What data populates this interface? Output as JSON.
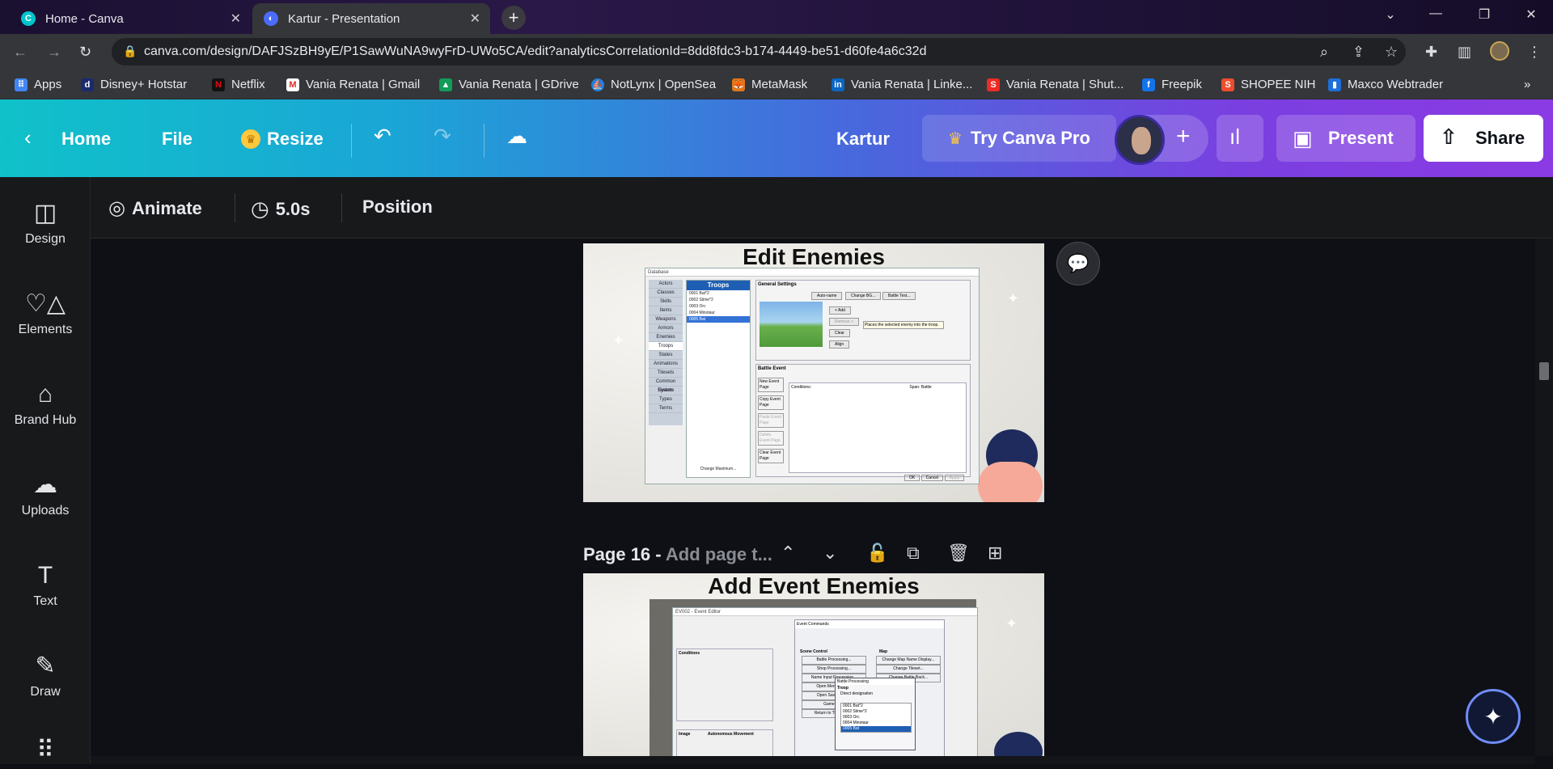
{
  "browser": {
    "tabs": [
      {
        "title": "Home - Canva",
        "active": false
      },
      {
        "title": "Kartur - Presentation",
        "active": true
      }
    ],
    "url": "canva.com/design/DAFJSzBH9yE/P1SawWuNA9wyFrD-UWo5CA/edit?analyticsCorrelationId=8dd8fdc3-b174-4449-be51-d60fe4a6c32d",
    "bookmarks": [
      {
        "label": "Apps",
        "icon": "apps-grid-icon"
      },
      {
        "label": "Disney+ Hotstar",
        "icon": "hotstar-icon"
      },
      {
        "label": "Netflix",
        "icon": "netflix-icon"
      },
      {
        "label": "Vania Renata | Gmail",
        "icon": "gmail-icon"
      },
      {
        "label": "Vania Renata | GDrive",
        "icon": "gdrive-icon"
      },
      {
        "label": "NotLynx | OpenSea",
        "icon": "opensea-icon"
      },
      {
        "label": "MetaMask",
        "icon": "metamask-icon"
      },
      {
        "label": "Vania Renata | Linke...",
        "icon": "linkedin-icon"
      },
      {
        "label": "Vania Renata | Shut...",
        "icon": "shutterstock-icon"
      },
      {
        "label": "Freepik",
        "icon": "freepik-icon"
      },
      {
        "label": "SHOPEE NIH",
        "icon": "shopee-icon"
      },
      {
        "label": "Maxco Webtrader",
        "icon": "maxco-icon"
      }
    ],
    "more_bookmarks": "»"
  },
  "canva_header": {
    "home": "Home",
    "file": "File",
    "resize": "Resize",
    "design_name": "Kartur",
    "try_pro": "Try Canva Pro",
    "present": "Present",
    "share": "Share"
  },
  "sidebar": {
    "items": [
      {
        "label": "Design",
        "icon": "layout-icon"
      },
      {
        "label": "Elements",
        "icon": "shapes-icon"
      },
      {
        "label": "Brand Hub",
        "icon": "brand-hub-icon"
      },
      {
        "label": "Uploads",
        "icon": "cloud-upload-icon"
      },
      {
        "label": "Text",
        "icon": "text-icon"
      },
      {
        "label": "Draw",
        "icon": "pen-icon"
      }
    ]
  },
  "toolbar": {
    "animate": "Animate",
    "duration": "5.0s",
    "position": "Position"
  },
  "pages": [
    {
      "title": "Edit Enemies",
      "screenshot": {
        "window_title": "Database",
        "tabs": [
          "Actors",
          "Classes",
          "Skills",
          "Items",
          "Weapons",
          "Armors",
          "Enemies",
          "Troops",
          "States",
          "Animations",
          "Tilesets",
          "Common Events",
          "System",
          "Types",
          "Terms"
        ],
        "list_header": "Troops",
        "list_items": [
          "0001 Bat*2",
          "0002 Slime*2",
          "0003 Orc",
          "0004 Minotaur",
          "0005 Bat"
        ],
        "general_settings": "General Settings",
        "buttons": [
          "Auto-name",
          "Change BG...",
          "Battle Test...",
          "< Add",
          "Remove >",
          "Clear",
          "Align"
        ],
        "tooltip": "Places the selected enemy into the troop.",
        "battle_event": "Battle Event",
        "event_buttons": [
          "New Event Page",
          "Copy Event Page",
          "Paste Event Page",
          "Delete Event Page",
          "Clear Event Page"
        ],
        "conditions": "Conditions:",
        "span": "Span:",
        "span_value": "Battle",
        "change_max": "Change Maximum...",
        "ok": "OK",
        "cancel": "Cancel",
        "apply": "Apply"
      }
    },
    {
      "page_prefix": "Page 16 -",
      "page_placeholder": "Add page t...",
      "title": "Add Event Enemies",
      "screenshot": {
        "window_title": "EV002 - Event Editor",
        "event_commands": "Event Commands",
        "scene_control": "Scene Control",
        "map": "Map",
        "dialog_title": "Battle Processing",
        "troop_label": "Troop",
        "direct_designation": "Direct designation",
        "troop_items": [
          "0001 Bat*2",
          "0002 Slime*2",
          "0003 Orc",
          "0004 Minotaur",
          "0005 Bat"
        ],
        "scene_buttons": [
          "Battle Processing...",
          "Shop Processing...",
          "Name Input Processing...",
          "Open Menu Screen",
          "Open Save Screen",
          "Game Over",
          "Return to Title Screen"
        ],
        "map_buttons": [
          "Change Map Name Display...",
          "Change Tileset...",
          "Change Battle Back..."
        ],
        "conditions": "Conditions",
        "image": "Image",
        "autonomous_movement": "Autonomous Movement"
      }
    }
  ]
}
